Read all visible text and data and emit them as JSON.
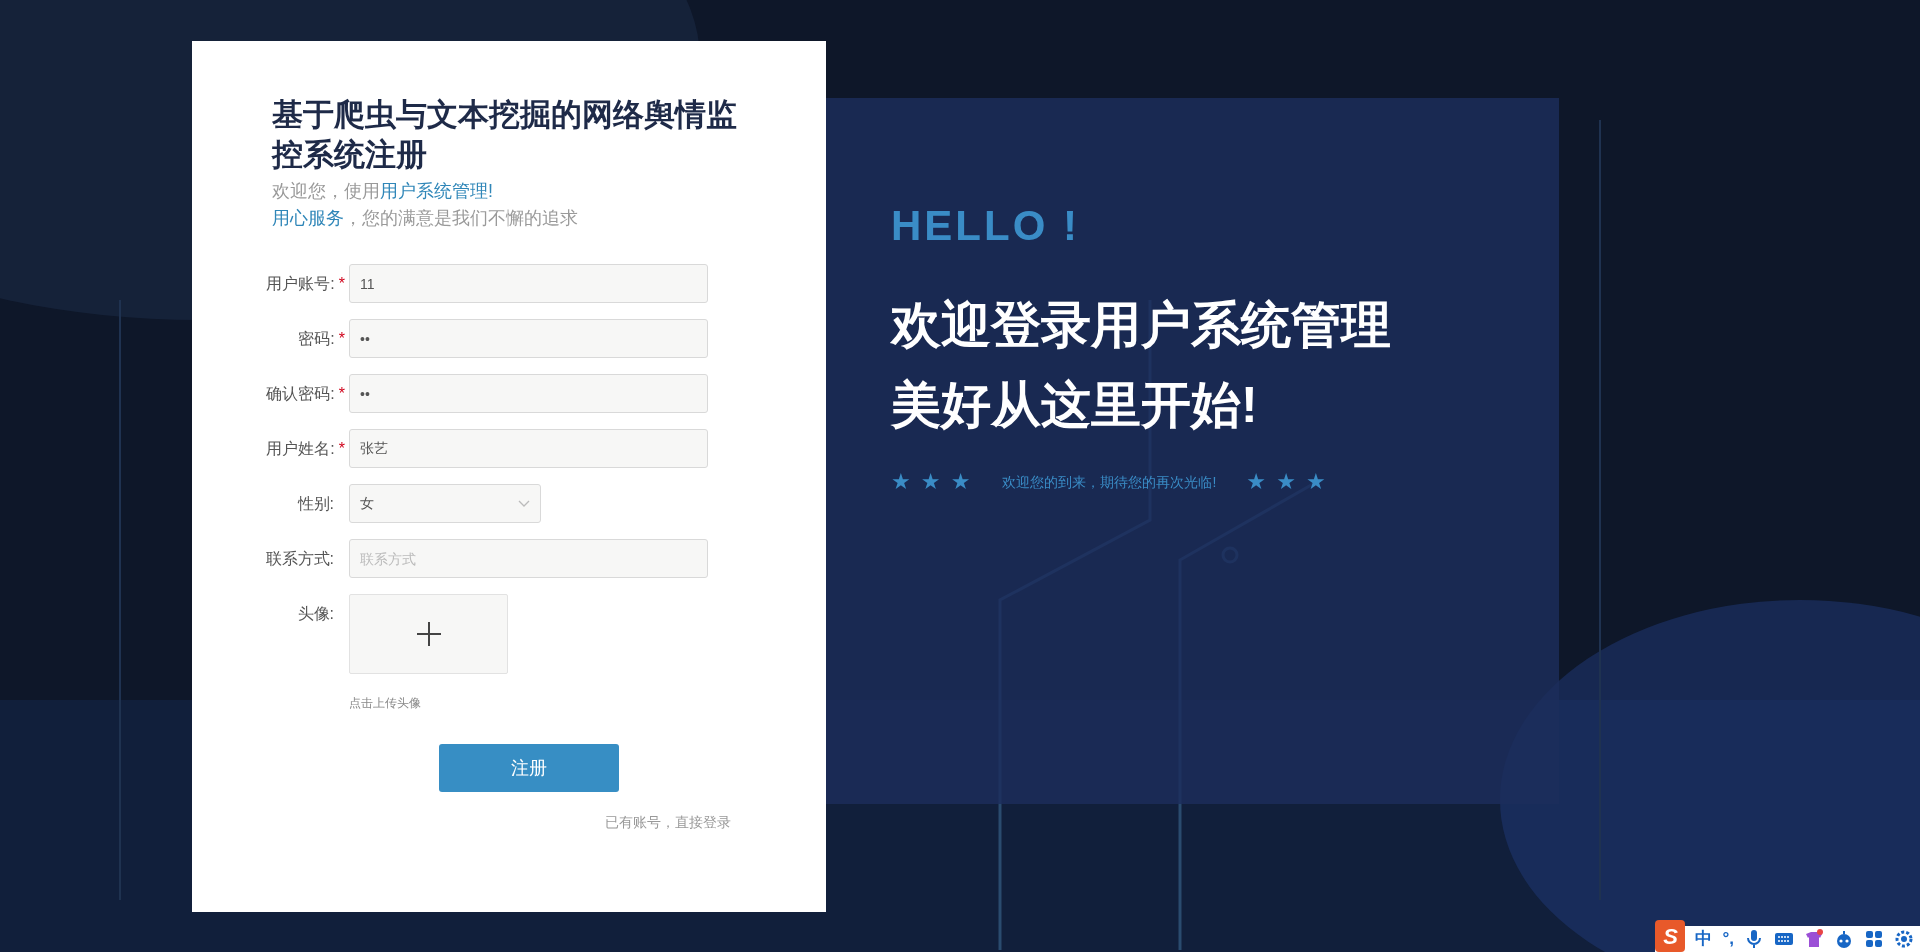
{
  "register_card": {
    "title": "基于爬虫与文本挖掘的网络舆情监控系统注册",
    "subtitle_lines": [
      [
        {
          "text": "欢迎您，使用",
          "highlight": false
        },
        {
          "text": "用户系统管理!",
          "highlight": true
        }
      ],
      [
        {
          "text": "用心服务",
          "highlight": true
        },
        {
          "text": "，您的满意是我们不懈的追求",
          "highlight": false
        }
      ]
    ],
    "fields": [
      {
        "kind": "text",
        "label": "用户账号:",
        "required_mark": "*",
        "value": "11"
      },
      {
        "kind": "password",
        "label": "密码:",
        "required_mark": "*",
        "value": "••"
      },
      {
        "kind": "password",
        "label": "确认密码:",
        "required_mark": "*",
        "value": "••"
      },
      {
        "kind": "text",
        "label": "用户姓名:",
        "required_mark": "*",
        "value": "张艺"
      },
      {
        "kind": "select",
        "label": "性别:",
        "value": "女"
      },
      {
        "kind": "text",
        "label": "联系方式:",
        "placeholder": "联系方式"
      },
      {
        "kind": "upload",
        "label": "头像:",
        "hint": "点击上传头像"
      }
    ],
    "submit_button": "注册",
    "login_link": "已有账号，直接登录"
  },
  "welcome_panel": {
    "hello": "HELLO !",
    "headline_lines": [
      "欢迎登录用户系统管理",
      "美好从这里开始!"
    ],
    "tagline": "欢迎您的到来，期待您的再次光临!",
    "stars_left": "★ ★ ★",
    "stars_right": "★ ★ ★"
  },
  "ime_toolbar": {
    "logo": "S",
    "mode": "中",
    "punctuation": "°,"
  }
}
